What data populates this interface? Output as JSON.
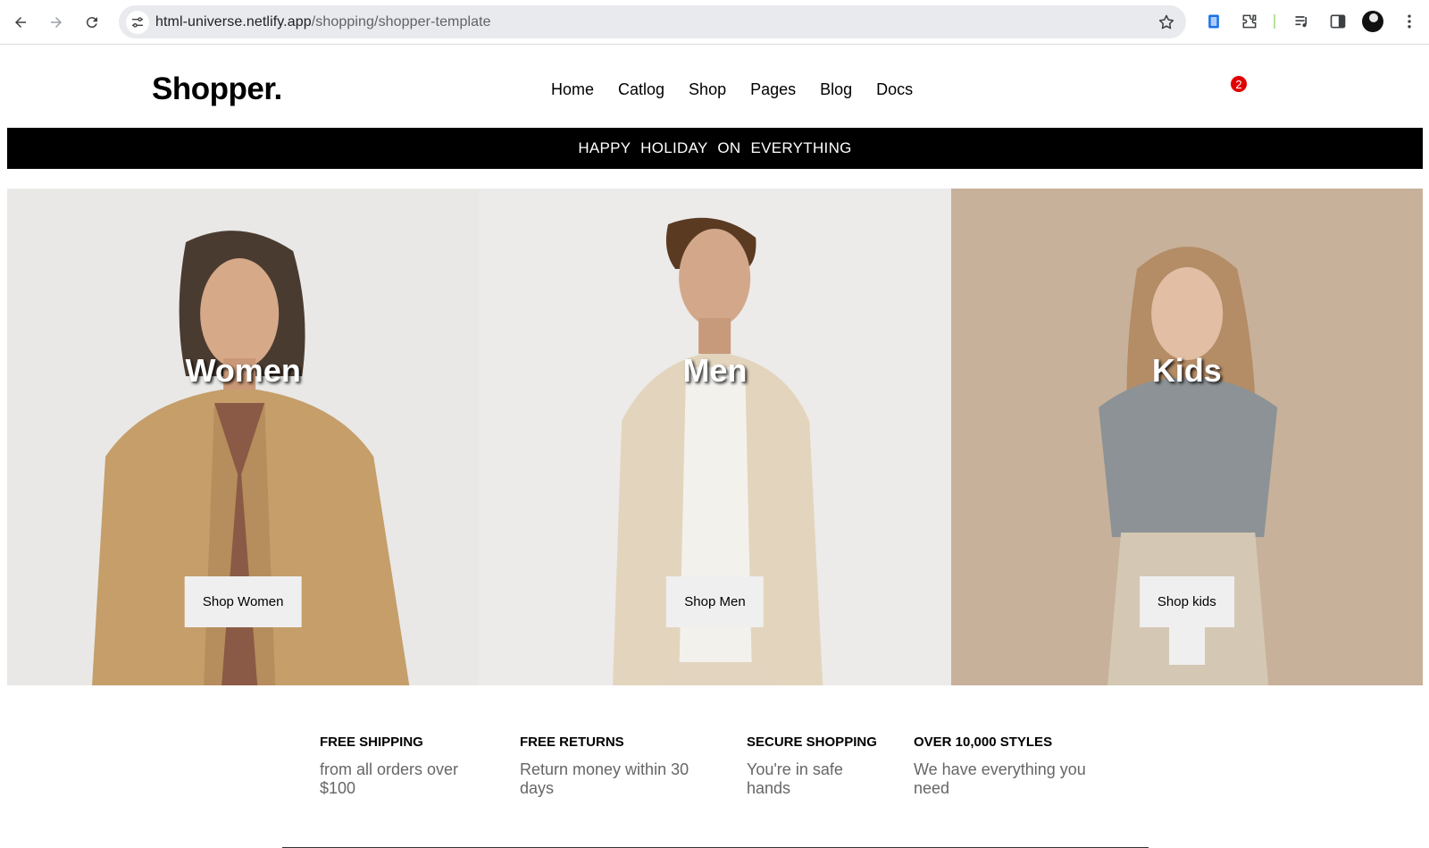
{
  "browser": {
    "url_host": "html-universe.netlify.app",
    "url_path": "/shopping/shopper-template",
    "icons": [
      "back-icon",
      "forward-icon",
      "reload-icon",
      "site-info-icon",
      "bookmark-star-icon",
      "extension-icon",
      "puzzle-icon",
      "media-control-icon",
      "side-panel-icon",
      "profile-avatar",
      "menu-dots-icon"
    ]
  },
  "header": {
    "logo": "Shopper.",
    "nav": [
      "Home",
      "Catlog",
      "Shop",
      "Pages",
      "Blog",
      "Docs"
    ],
    "cart_count": "2"
  },
  "promo": {
    "text": "HAPPY HOLIDAY ON EVERYTHING"
  },
  "hero": {
    "panels": [
      {
        "title": "Women",
        "button": "Shop Women"
      },
      {
        "title": "Men",
        "button": "Shop Men"
      },
      {
        "title": "Kids",
        "button": "Shop kids"
      }
    ]
  },
  "features": [
    {
      "title": "FREE SHIPPING",
      "text": "from all orders over $100"
    },
    {
      "title": "FREE RETURNS",
      "text": "Return money within 30 days"
    },
    {
      "title": "SECURE SHOPPING",
      "text": "You're in safe hands"
    },
    {
      "title": "OVER 10,000 STYLES",
      "text": "We have everything you need"
    }
  ],
  "colors": {
    "promo_bg": "#000000",
    "badge": "#e00000",
    "button_bg": "#efefef"
  }
}
